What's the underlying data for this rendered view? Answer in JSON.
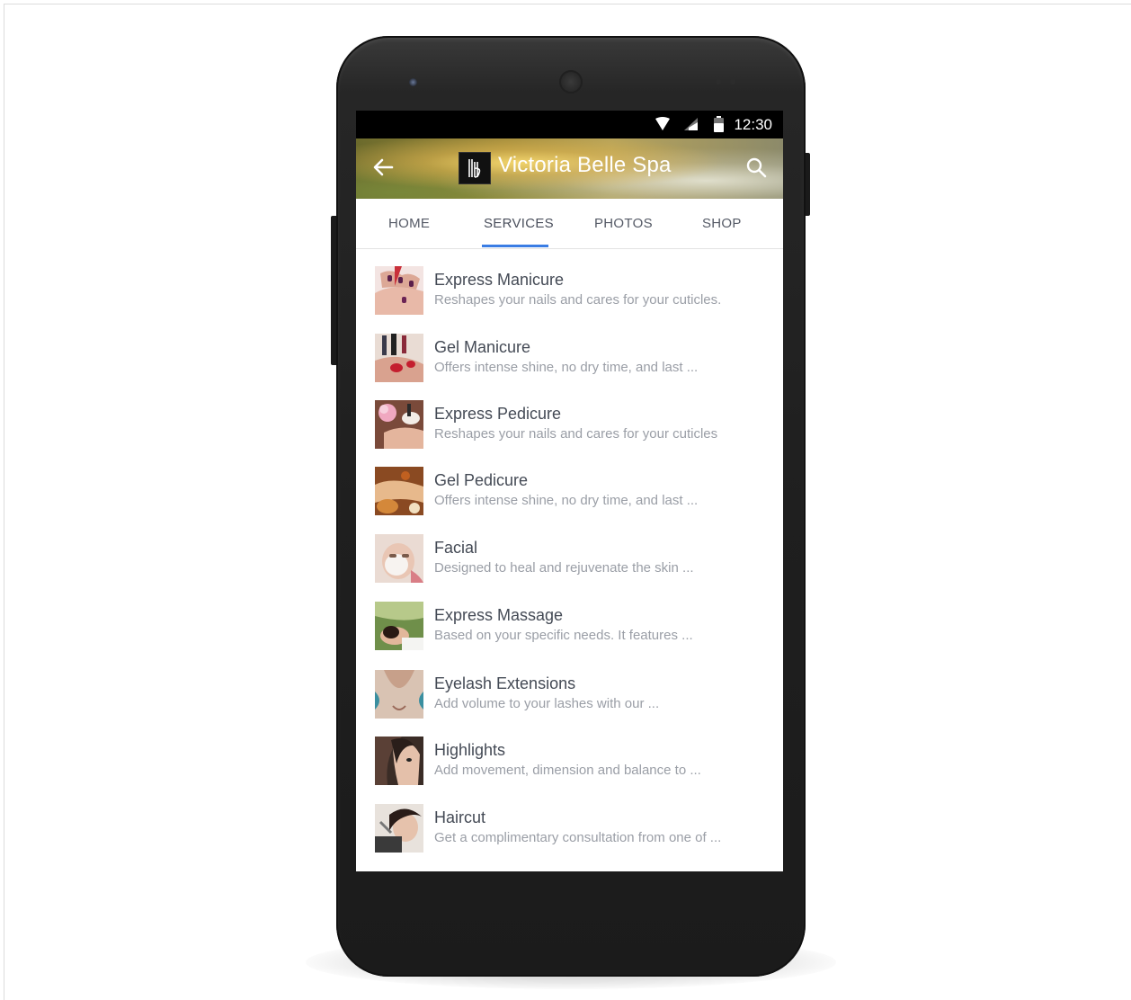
{
  "status_bar": {
    "time": "12:30"
  },
  "app_bar": {
    "title": "Victoria Belle Spa",
    "logo_text": "VB"
  },
  "tabs": [
    {
      "label": "HOME"
    },
    {
      "label": "SERVICES"
    },
    {
      "label": "PHOTOS"
    },
    {
      "label": "SHOP"
    }
  ],
  "active_tab": "SERVICES",
  "services": [
    {
      "title": "Express Manicure",
      "description": "Reshapes your nails and cares for your cuticles."
    },
    {
      "title": "Gel Manicure",
      "description": "Offers intense shine, no dry time, and last ..."
    },
    {
      "title": "Express Pedicure",
      "description": "Reshapes your nails and cares for your cuticles"
    },
    {
      "title": "Gel Pedicure",
      "description": "Offers intense shine, no dry time, and last ..."
    },
    {
      "title": "Facial",
      "description": "Designed to heal and rejuvenate the skin ..."
    },
    {
      "title": "Express Massage",
      "description": "Based on your specific needs. It features ..."
    },
    {
      "title": "Eyelash Extensions",
      "description": "Add volume to your lashes with our ..."
    },
    {
      "title": "Highlights",
      "description": "Add movement, dimension and balance to ..."
    },
    {
      "title": "Haircut",
      "description": "Get a complimentary consultation from one of ..."
    }
  ],
  "colors": {
    "tab_indicator": "#3a7de4",
    "status_bar": "#000000",
    "title_text": "#444a55",
    "description_text": "#9a9ea6"
  }
}
